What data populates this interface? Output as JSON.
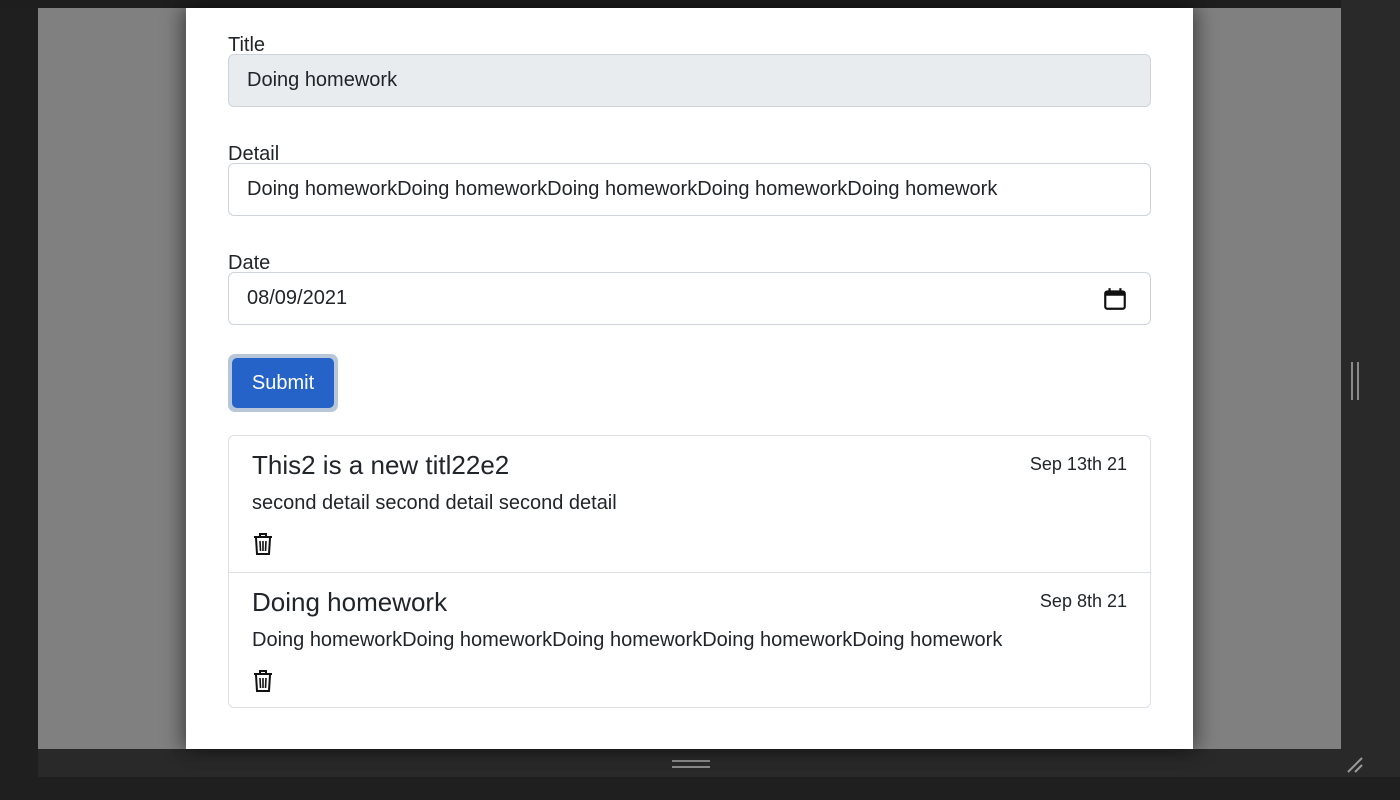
{
  "form": {
    "title_label": "Title",
    "title_value": "Doing homework",
    "detail_label": "Detail",
    "detail_value": "Doing homeworkDoing homeworkDoing homeworkDoing homeworkDoing homework",
    "date_label": "Date",
    "date_value": "08/09/2021",
    "submit_label": "Submit",
    "calendar_icon": "calendar-icon"
  },
  "todos": [
    {
      "title": "This2 is a new titl22e2",
      "date": "Sep 13th 21",
      "detail": "second detail second detail second detail",
      "delete_icon": "trash-icon"
    },
    {
      "title": "Doing homework",
      "date": "Sep 8th 21",
      "detail": "Doing homeworkDoing homeworkDoing homeworkDoing homeworkDoing homework",
      "delete_icon": "trash-icon"
    }
  ],
  "colors": {
    "primary": "#2563c9",
    "border": "#ced4da",
    "text": "#212529"
  }
}
